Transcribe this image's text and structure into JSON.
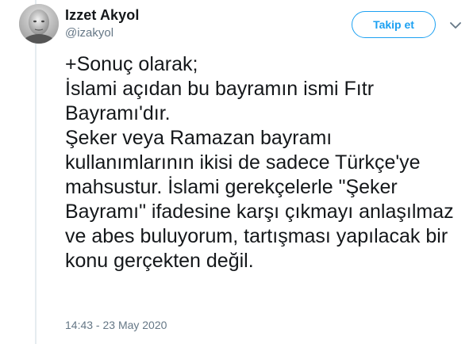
{
  "tweet": {
    "author_name": "Izzet Akyol",
    "author_handle": "@izakyol",
    "follow_label": "Takip et",
    "text": "+Sonuç olarak;\nİslami açıdan bu bayramın ismi Fıtr Bayramı'dır.\nŞeker veya Ramazan bayramı kullanımlarının ikisi de sadece Türkçe'ye mahsustur. İslami gerekçelerle \"Şeker Bayramı\" ifadesine karşı çıkmayı anlaşılmaz ve abes buluyorum, tartışması yapılacak bir konu gerçekten değil.",
    "timestamp": "14:43 - 23 May 2020"
  },
  "icons": {
    "avatar": "profile-photo",
    "more": "chevron-down-icon"
  },
  "colors": {
    "accent": "#1da1f2",
    "text": "#14171a",
    "secondary_text": "#657786",
    "divider": "#e6ecf0"
  }
}
